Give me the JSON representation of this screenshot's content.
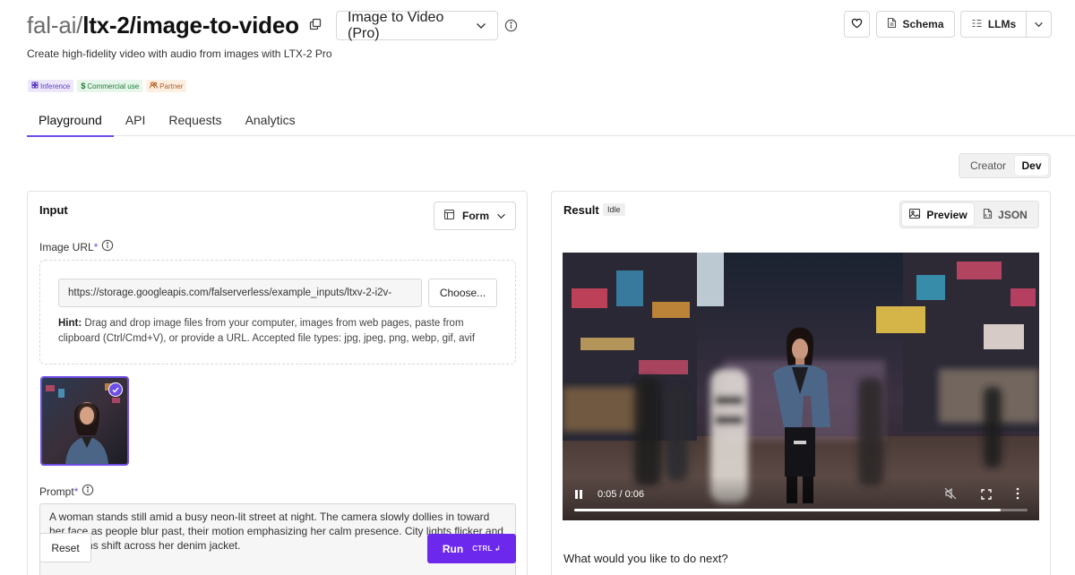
{
  "header": {
    "org": "fal-ai",
    "slash": "/",
    "model": "ltx-2/image-to-video",
    "variant": "Image to Video (Pro)",
    "subtitle": "Create high-fidelity video with audio from images with LTX-2 Pro",
    "schema_label": "Schema",
    "llms_label": "LLMs"
  },
  "badges": [
    {
      "label": "Inference",
      "icon": "inference-icon"
    },
    {
      "label": "Commercial use",
      "icon": "dollar-icon"
    },
    {
      "label": "Partner",
      "icon": "partner-icon"
    }
  ],
  "tabs": [
    "Playground",
    "API",
    "Requests",
    "Analytics"
  ],
  "active_tab": "Playground",
  "mode": {
    "creator": "Creator",
    "dev": "Dev",
    "active": "Dev"
  },
  "input": {
    "title": "Input",
    "form_label": "Form",
    "image_url_label": "Image URL",
    "required_mark": "*",
    "image_url_value": "https://storage.googleapis.com/falserverless/example_inputs/ltxv-2-i2v-",
    "choose_label": "Choose...",
    "hint_bold": "Hint:",
    "hint_text": " Drag and drop image files from your computer, images from web pages, paste from clipboard (Ctrl/Cmd+V), or provide a URL. Accepted file types: jpg, jpeg, png, webp, gif, avif",
    "prompt_label": "Prompt",
    "prompt_value": "A woman stands still amid a busy neon-lit street at night. The camera slowly dollies in toward her face as people blur past, their motion emphasizing her calm presence. City lights flicker and reflections shift across her denim jacket.",
    "reset_label": "Reset",
    "run_label": "Run",
    "run_shortcut": "CTRL ↲"
  },
  "result": {
    "title": "Result",
    "status": "Idle",
    "preview_label": "Preview",
    "json_label": "JSON",
    "time": "0:05 / 0:06",
    "progress": 0.94,
    "next_question": "What would you like to do next?"
  },
  "colors": {
    "accent": "#6d4de6",
    "run_button": "#6d28ee"
  }
}
